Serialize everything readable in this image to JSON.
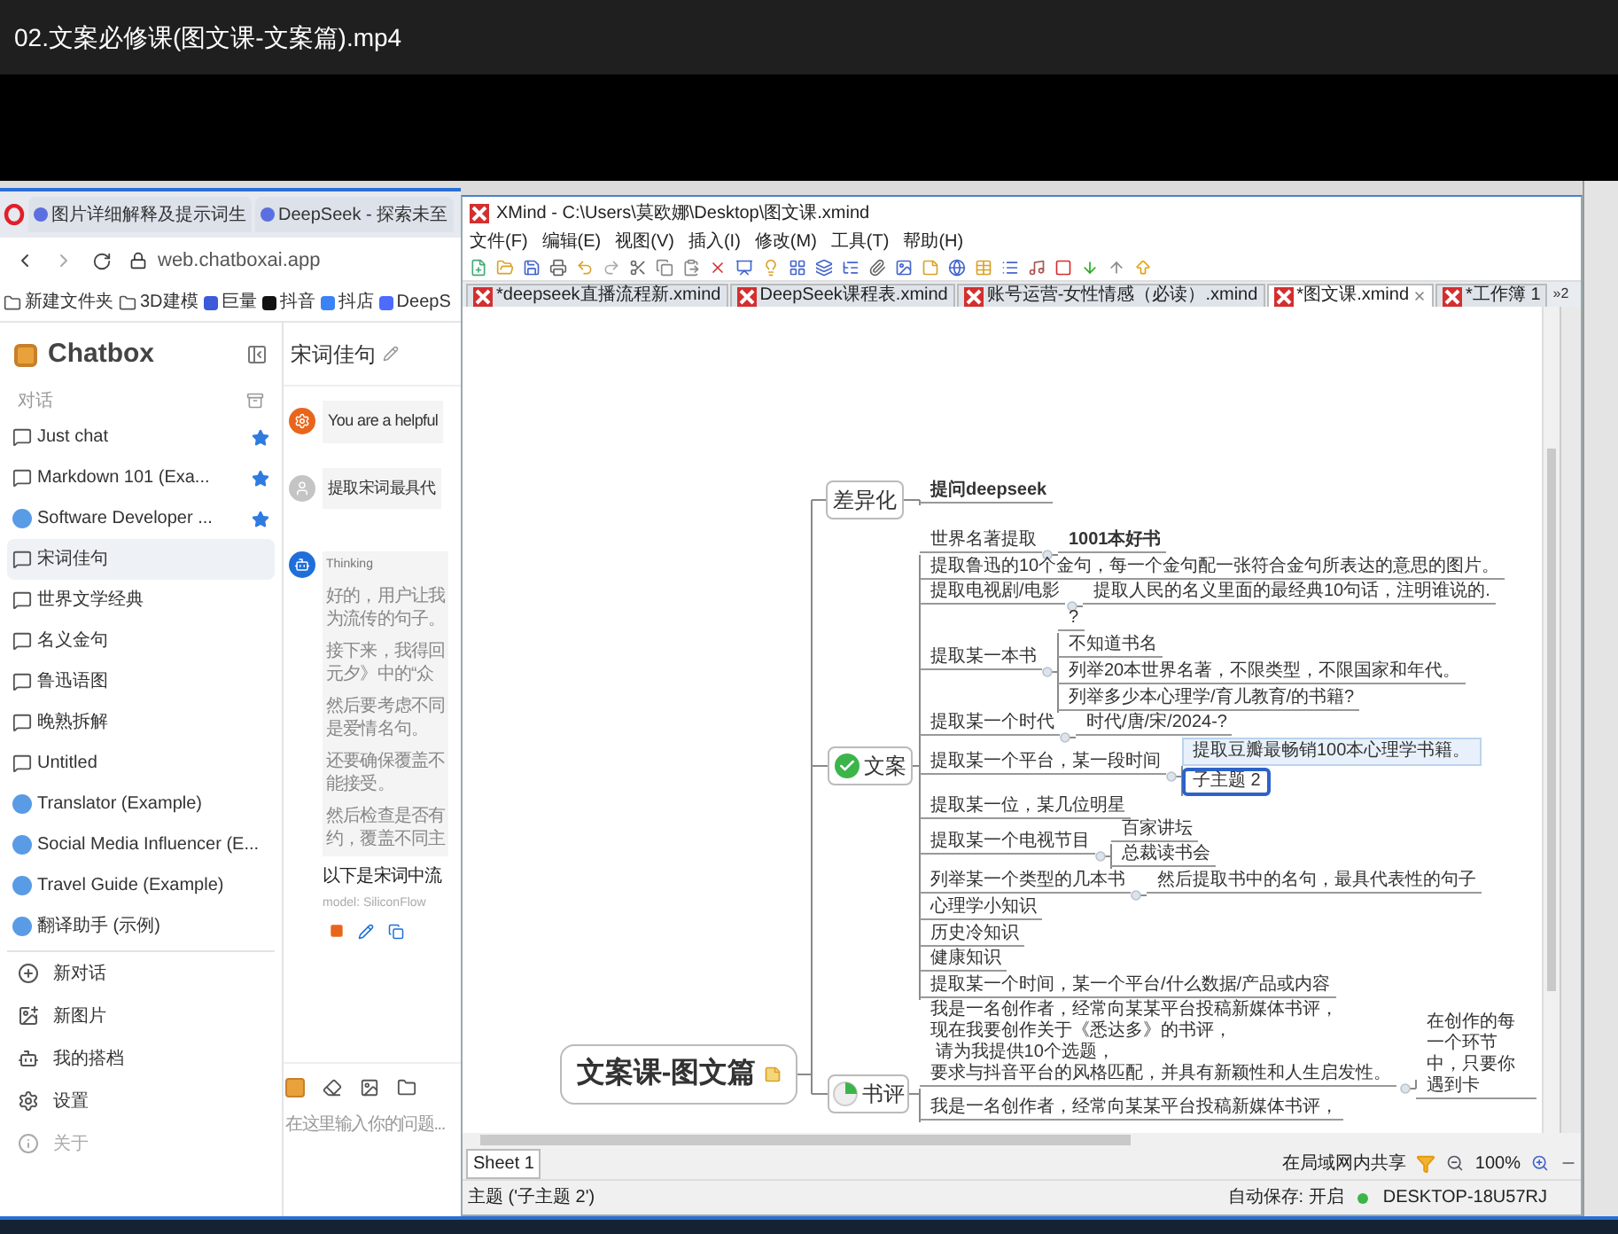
{
  "video_title": "02.文案必修课(图文课-文案篇).mp4",
  "browser": {
    "tabs": [
      {
        "label": "图片详细解释及提示词生"
      },
      {
        "label": "DeepSeek - 探索未至"
      }
    ],
    "address": "web.chatboxai.app",
    "bookmarks": [
      {
        "label": "新建文件夹",
        "kind": "folder"
      },
      {
        "label": "3D建模",
        "kind": "folder"
      },
      {
        "label": "巨量",
        "kind": "site",
        "color": "#3b5bdb"
      },
      {
        "label": "抖音",
        "kind": "site",
        "color": "#111111"
      },
      {
        "label": "抖店",
        "kind": "site",
        "color": "#3b82f6"
      },
      {
        "label": "DeepS",
        "kind": "site",
        "color": "#4d6bfe"
      }
    ]
  },
  "chatbox": {
    "app_name": "Chatbox",
    "section_label": "对话",
    "conversations": [
      {
        "label": "Just chat",
        "kind": "chat",
        "starred": true,
        "selected": false
      },
      {
        "label": "Markdown 101 (Exa...",
        "kind": "chat",
        "starred": true,
        "selected": false
      },
      {
        "label": "Software Developer ...",
        "kind": "assistant",
        "starred": true,
        "selected": false
      },
      {
        "label": "宋词佳句",
        "kind": "chat",
        "starred": false,
        "selected": true
      },
      {
        "label": "世界文学经典",
        "kind": "chat",
        "starred": false,
        "selected": false
      },
      {
        "label": "名义金句",
        "kind": "chat",
        "starred": false,
        "selected": false
      },
      {
        "label": "鲁迅语图",
        "kind": "chat",
        "starred": false,
        "selected": false
      },
      {
        "label": "晚熟拆解",
        "kind": "chat",
        "starred": false,
        "selected": false
      },
      {
        "label": "Untitled",
        "kind": "chat",
        "starred": false,
        "selected": false
      },
      {
        "label": "Translator (Example)",
        "kind": "assistant",
        "starred": false,
        "selected": false
      },
      {
        "label": "Social Media Influencer (E...",
        "kind": "assistant",
        "starred": false,
        "selected": false
      },
      {
        "label": "Travel Guide (Example)",
        "kind": "assistant",
        "starred": false,
        "selected": false
      },
      {
        "label": "翻译助手 (示例)",
        "kind": "assistant",
        "starred": false,
        "selected": false
      }
    ],
    "actions": [
      {
        "label": "新对话",
        "kind": "new-chat",
        "disabled": false
      },
      {
        "label": "新图片",
        "kind": "new-image",
        "disabled": false
      },
      {
        "label": "我的搭档",
        "kind": "partners",
        "disabled": false
      },
      {
        "label": "设置",
        "kind": "settings",
        "disabled": false
      },
      {
        "label": "关于",
        "kind": "about",
        "disabled": true
      }
    ],
    "chat": {
      "title": "宋词佳句",
      "messages": [
        {
          "kind": "system",
          "text": "You are a helpful"
        },
        {
          "kind": "user",
          "text": "提取宋词最具代"
        },
        {
          "kind": "assistant",
          "thinking_label": "Thinking",
          "thinking": [
            [
              "好的，用户让我",
              "为流传的句子。"
            ],
            [
              "接下来，我得回",
              "元夕》中的“众"
            ],
            [
              "然后要考虑不同",
              "是爱情名句。"
            ],
            [
              "还要确保覆盖不",
              "能接受。"
            ],
            [
              "然后检查是否有",
              "约，覆盖不同主"
            ]
          ],
          "answer": "以下是宋词中流",
          "model": "model: SiliconFlow"
        }
      ],
      "input_placeholder": "在这里输入你的问题..."
    }
  },
  "xmind": {
    "title": "XMind - C:\\Users\\莫欧娜\\Desktop\\图文课.xmind",
    "menu": [
      "文件(F)",
      "编辑(E)",
      "视图(V)",
      "插入(I)",
      "修改(M)",
      "工具(T)",
      "帮助(H)"
    ],
    "tabs": [
      {
        "label": "*deepseek直播流程新.xmind",
        "selected": false
      },
      {
        "label": "DeepSeek课程表.xmind",
        "selected": false
      },
      {
        "label": "账号运营-女性情感（必读）.xmind",
        "selected": false
      },
      {
        "label": "*图文课.xmind",
        "selected": true
      },
      {
        "label": "*工作簿 1",
        "selected": false
      }
    ],
    "more_tabs": "»2",
    "mind_map": {
      "central_topic": "文案课-图文篇",
      "has_note": true,
      "branches": [
        {
          "label": "差异化",
          "kind": "plain",
          "children": [
            {
              "label": "提问deepseek",
              "bold": true
            }
          ]
        },
        {
          "label": "文案",
          "kind": "check",
          "children": [
            {
              "label": "世界名著提取",
              "children": [
                {
                  "label": "1001本好书",
                  "bold": true
                }
              ]
            },
            {
              "label": "提取鲁迅的10个金句，每一个金句配一张符合金句所表达的意思的图片。"
            },
            {
              "label": "提取电视剧/电影",
              "children": [
                {
                  "label": "提取人民的名义里面的最经典10句话，注明谁说的."
                }
              ]
            },
            {
              "label": "提取某一本书",
              "children": [
                {
                  "label": "?"
                },
                {
                  "label": "不知道书名"
                },
                {
                  "label": "列举20本世界名著，不限类型，不限国家和年代。"
                },
                {
                  "label": "列举多少本心理学/育儿教育/的书籍?"
                }
              ]
            },
            {
              "label": "提取某一个时代",
              "children": [
                {
                  "label": "时代/唐/宋/2024-?"
                }
              ]
            },
            {
              "label": "提取某一个平台，某一段时间",
              "children": [
                {
                  "label": "提取豆瓣最畅销100本心理学书籍。",
                  "selected": false,
                  "hovered": true
                },
                {
                  "label": "子主题 2",
                  "selected": true,
                  "hovered": false
                }
              ]
            },
            {
              "label": "提取某一位，某几位明星"
            },
            {
              "label": "提取某一个电视节目",
              "children": [
                {
                  "label": "百家讲坛"
                },
                {
                  "label": "总裁读书会"
                }
              ]
            },
            {
              "label": "列举某一个类型的几本书",
              "children": [
                {
                  "label": "然后提取书中的名句，最具代表性的句子"
                }
              ]
            },
            {
              "label": "心理学小知识"
            },
            {
              "label": "历史冷知识"
            },
            {
              "label": "健康知识"
            },
            {
              "label": "提取某一个时间，某一个平台/什么数据/产品或内容"
            }
          ]
        },
        {
          "label": "书评",
          "kind": "pie",
          "children": [
            {
              "lines": [
                "我是一名创作者，经常向某某平台投稿新媒体书评，",
                "现在我要创作关于《悉达多》的书评，",
                " 请为我提供10个选题，",
                "要求与抖音平台的风格匹配，并具有新颖性和人生启发性。"
              ],
              "children": [
                {
                  "label": "在创作的每一个环节中，只要你遇到卡"
                }
              ]
            },
            {
              "label": "我是一名创作者，经常向某某平台投稿新媒体书评，"
            }
          ]
        }
      ]
    },
    "sheet_tab": "Sheet 1",
    "share_label": "在局域网内共享",
    "zoom": "100%",
    "status": "主题 ('子主题 2')",
    "autosave": "自动保存: 开启",
    "computer": "DESKTOP-18U57RJ"
  }
}
